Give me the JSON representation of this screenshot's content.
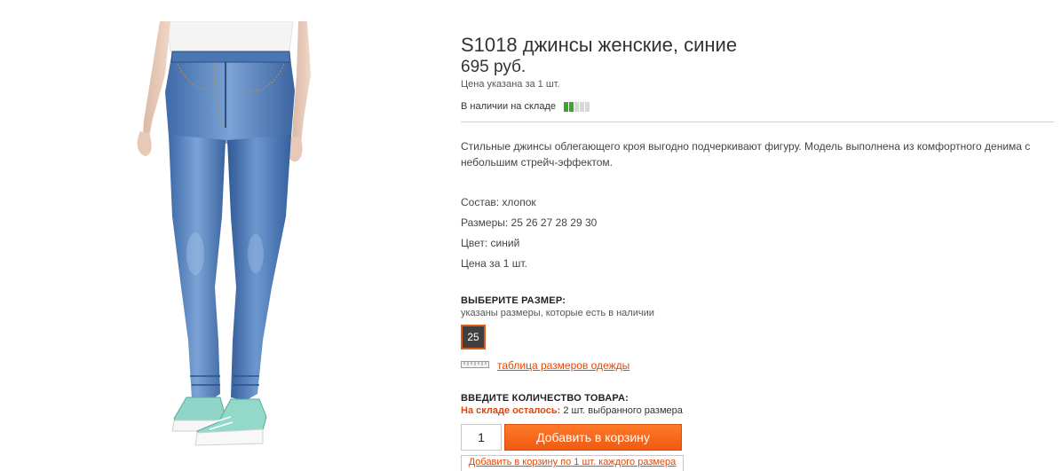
{
  "product": {
    "image_alt": "",
    "title": "S1018 джинсы женские, синие",
    "price": "695 руб.",
    "price_note": "Цена указана за 1 шт.",
    "stock_status": "В наличии на складе",
    "stock_level": 0.4,
    "description": "Стильные джинсы облегающего кроя выгодно подчеркивают фигуру. Модель выполнена из комфортного денима с небольшим стрейч-эффектом.",
    "attributes": {
      "composition": "Состав: хлопок",
      "sizes": "Размеры: 25 26 27 28 29 30",
      "color": "Цвет: синий",
      "price_per": "Цена за 1 шт."
    }
  },
  "size_select": {
    "heading": "ВЫБЕРИТЕ РАЗМЕР:",
    "subheading": "указаны размеры, которые есть в наличии",
    "options": [
      "25"
    ],
    "selected": "25",
    "size_table_link": "таблица размеров одежды",
    "icon": "ruler-icon"
  },
  "quantity": {
    "heading": "ВВЕДИТЕ КОЛИЧЕСТВО ТОВАРА:",
    "stock_left_label": "На складе осталось:",
    "stock_left_value": "2 шт. выбранного размера",
    "value": "1",
    "add_button": "Добавить в корзину",
    "add_each_link": "Добавить в корзину по 1 шт. каждого размера"
  },
  "colors": {
    "accent": "#f05a10",
    "link": "#e04a0a",
    "stock_on": "#3aa62a",
    "stock_off": "#d8d8d8"
  }
}
